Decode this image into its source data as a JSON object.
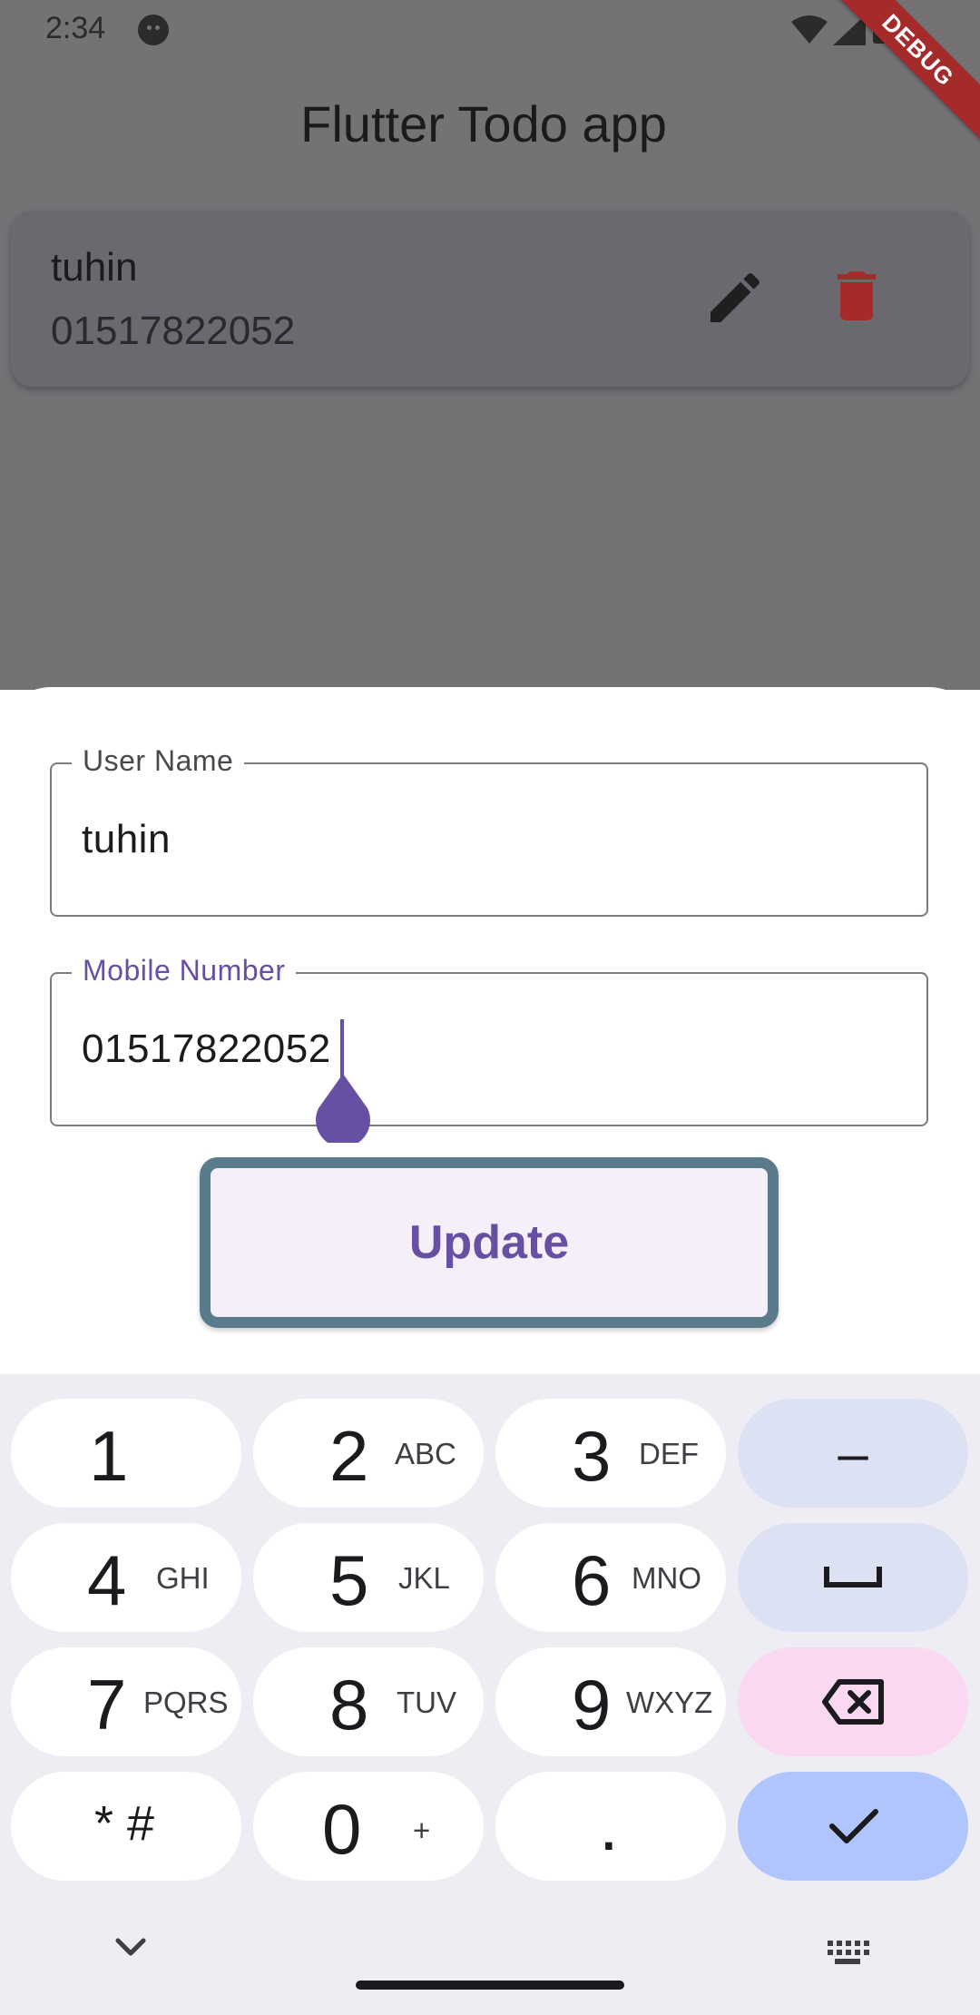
{
  "status_bar": {
    "time": "2:34"
  },
  "debug_banner": "DEBUG",
  "app": {
    "title": "Flutter Todo app"
  },
  "todo_items": [
    {
      "name": "tuhin",
      "phone": "01517822052"
    }
  ],
  "colors": {
    "accent": "#6750a4",
    "delete": "#a52a2a",
    "update_border": "#5a7b8c",
    "scrim_bg": "#747275"
  },
  "form": {
    "username": {
      "label": "User Name",
      "value": "tuhin"
    },
    "mobile": {
      "label": "Mobile Number",
      "value": "01517822052"
    },
    "update_label": "Update"
  },
  "keyboard": {
    "keys": [
      {
        "num": "1",
        "letters": ""
      },
      {
        "num": "2",
        "letters": "ABC"
      },
      {
        "num": "3",
        "letters": "DEF"
      },
      {
        "num": "4",
        "letters": "GHI"
      },
      {
        "num": "5",
        "letters": "JKL"
      },
      {
        "num": "6",
        "letters": "MNO"
      },
      {
        "num": "7",
        "letters": "PQRS"
      },
      {
        "num": "8",
        "letters": "TUV"
      },
      {
        "num": "9",
        "letters": "WXYZ"
      },
      {
        "num": "* #",
        "letters": ""
      },
      {
        "num": "0",
        "letters": "+"
      },
      {
        "num": ".",
        "letters": ""
      }
    ],
    "minus": "–",
    "icons": [
      "space-icon",
      "backspace-icon",
      "checkmark-icon",
      "chevron-down-icon",
      "keyboard-icon"
    ]
  }
}
